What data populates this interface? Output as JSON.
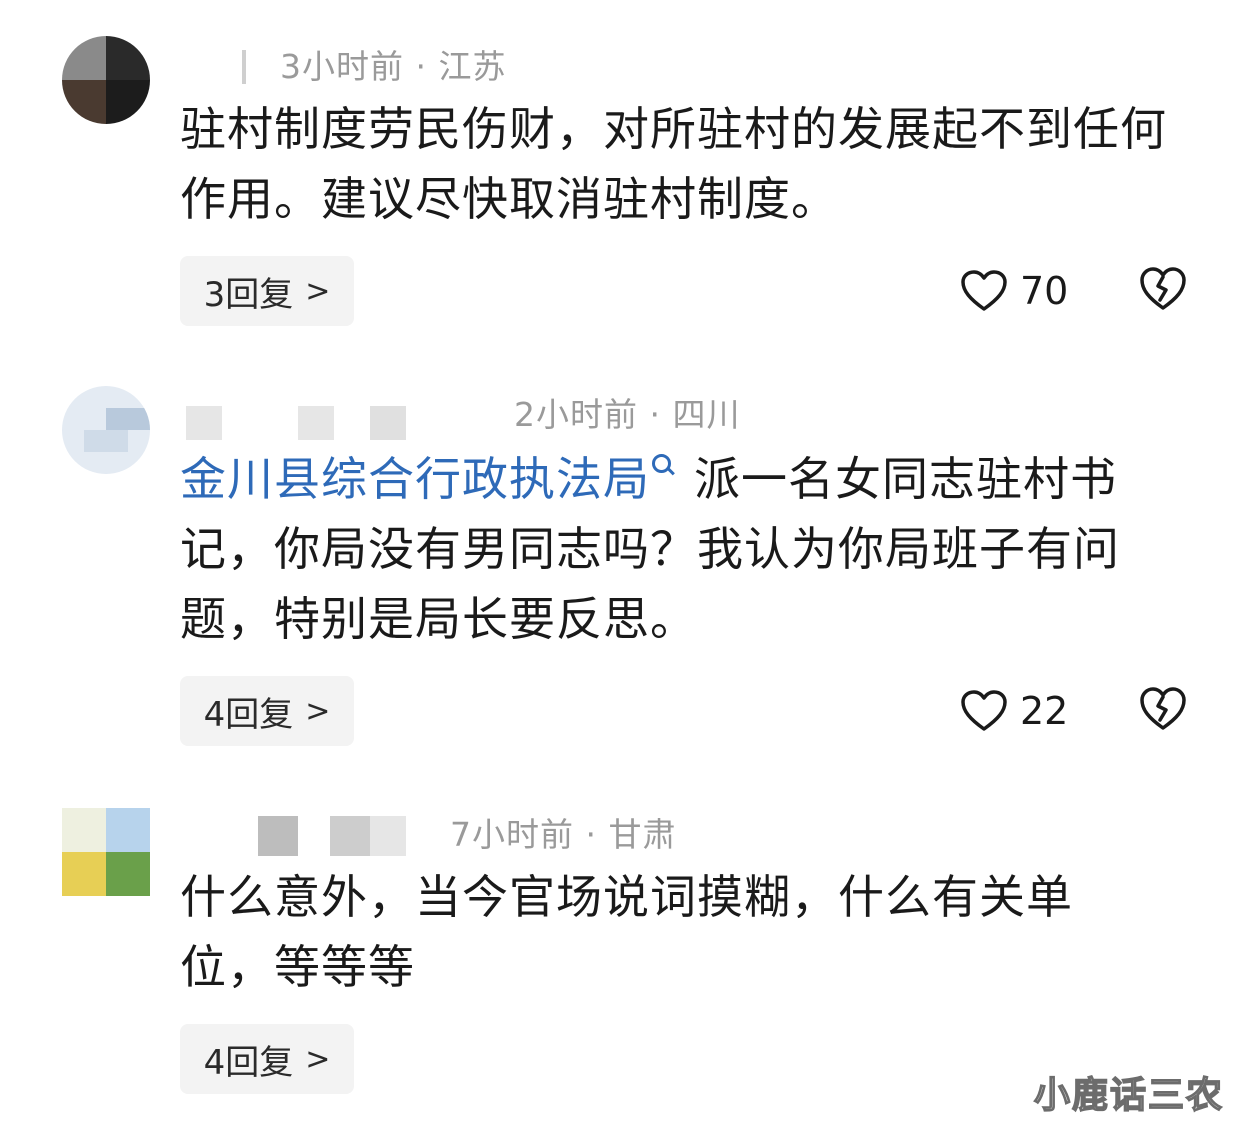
{
  "comments": [
    {
      "meta": "3小时前 · 江苏",
      "text": "驻村制度劳民伤财，对所驻村的发展起不到任何作用。建议尽快取消驻村制度。",
      "reply_label": "3回复",
      "likes": "70"
    },
    {
      "meta": "2小时前 · 四川",
      "mention": "金川县综合行政执法局",
      "text": "派一名女同志驻村书记，你局没有男同志吗？我认为你局班子有问题，特别是局长要反思。",
      "reply_label": "4回复",
      "likes": "22"
    },
    {
      "meta": "7小时前 · 甘肃",
      "text": "什么意外，当今官场说词摸糊，什么有关单位，等等等",
      "reply_label": "4回复"
    }
  ],
  "watermark": "小鹿话三农",
  "colors": {
    "mention": "#2e6ab8",
    "meta": "#9a9a9a",
    "reply_bg": "#f3f3f3"
  },
  "icons": {
    "like": "heart-outline-icon",
    "dislike": "broken-heart-icon",
    "more": "chevron-right-icon"
  }
}
